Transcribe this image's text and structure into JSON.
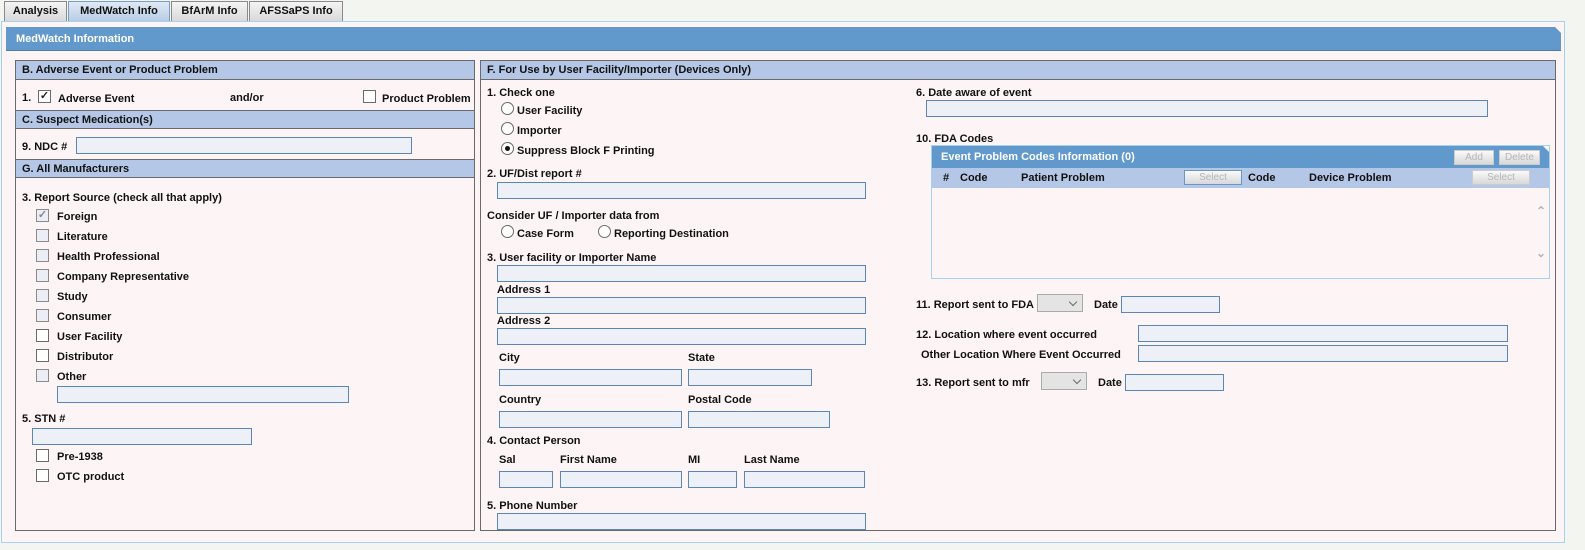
{
  "tabs": [
    {
      "label": "Analysis",
      "active": false
    },
    {
      "label": "MedWatch Info",
      "active": true
    },
    {
      "label": "BfArM Info",
      "active": false
    },
    {
      "label": "AFSSaPS Info",
      "active": false
    }
  ],
  "main_header": "MedWatch Information",
  "section_b": {
    "title": "B. Adverse Event or Product Problem",
    "item_num": "1.",
    "adverse_event_label": "Adverse Event",
    "adverse_event_checked": true,
    "andor": "and/or",
    "product_problem_label": "Product Problem",
    "product_problem_checked": false
  },
  "section_c": {
    "title": "C. Suspect Medication(s)",
    "ndc_label": "9. NDC #",
    "ndc_value": ""
  },
  "section_g": {
    "title": "G. All Manufacturers",
    "report_source_label": "3. Report Source (check all that apply)",
    "report_sources": [
      {
        "label": "Foreign",
        "checked": true
      },
      {
        "label": "Literature",
        "checked": false
      },
      {
        "label": "Health Professional",
        "checked": false
      },
      {
        "label": "Company Representative",
        "checked": false
      },
      {
        "label": "Study",
        "checked": false
      },
      {
        "label": "Consumer",
        "checked": false
      },
      {
        "label": "User Facility",
        "checked": false
      },
      {
        "label": "Distributor",
        "checked": false
      },
      {
        "label": "Other",
        "checked": false
      }
    ],
    "other_value": "",
    "stn_label": "5. STN #",
    "stn_value": "",
    "pre1938_label": "Pre-1938",
    "otc_label": "OTC product"
  },
  "section_f": {
    "title": "F. For Use by User Facility/Importer (Devices Only)",
    "check_one_label": "1. Check one",
    "check_one_options": [
      {
        "label": "User Facility",
        "selected": false
      },
      {
        "label": "Importer",
        "selected": false
      },
      {
        "label": "Suppress Block F Printing",
        "selected": true
      }
    ],
    "uf_dist_label": "2. UF/Dist report #",
    "consider_label": "Consider UF / Importer data from",
    "consider_options": [
      {
        "label": "Case Form",
        "selected": false
      },
      {
        "label": "Reporting Destination",
        "selected": false
      }
    ],
    "facility_name_label": "3. User facility or Importer Name",
    "address1_label": "Address 1",
    "address2_label": "Address 2",
    "city_label": "City",
    "state_label": "State",
    "country_label": "Country",
    "postal_label": "Postal Code",
    "contact_label": "4. Contact Person",
    "sal_label": "Sal",
    "first_name_label": "First Name",
    "mi_label": "MI",
    "last_name_label": "Last Name",
    "phone_label": "5. Phone Number",
    "date_aware_label": "6. Date aware of event",
    "fda_codes_label": "10. FDA Codes",
    "codes_grid": {
      "title": "Event Problem Codes Information (0)",
      "add_label": "Add",
      "delete_label": "Delete",
      "columns": [
        "#",
        "Code",
        "Patient Problem",
        "Code",
        "Device Problem"
      ],
      "select_label": "Select"
    },
    "report_fda_label": "11. Report sent to FDA",
    "date_label": "Date",
    "location_label": "12. Location where event occurred",
    "other_location_label": "Other Location Where Event Occurred",
    "report_mfr_label": "13. Report sent to mfr"
  }
}
